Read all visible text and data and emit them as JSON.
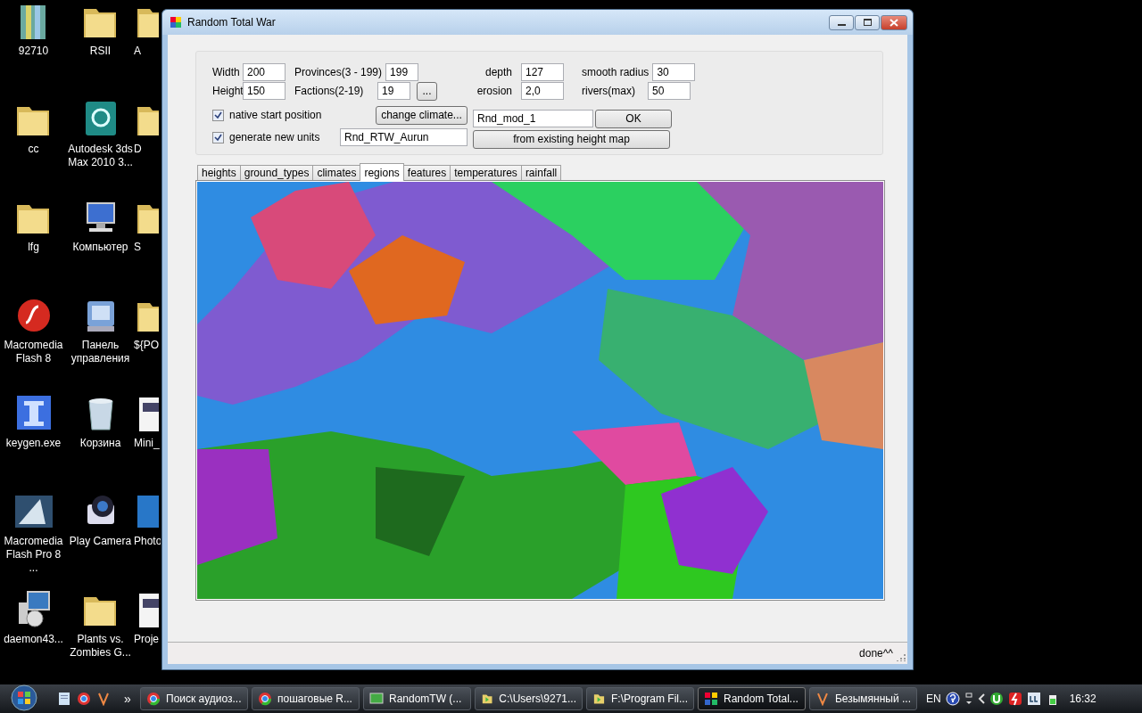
{
  "desktop": {
    "icons": [
      {
        "label": "92710",
        "kind": "archive"
      },
      {
        "label": "RSII",
        "kind": "folder"
      },
      {
        "label": "A",
        "kind": "folder"
      },
      {
        "label": "cc",
        "kind": "folder"
      },
      {
        "label": "Autodesk 3ds Max 2010 3...",
        "kind": "max"
      },
      {
        "label": "D",
        "kind": "folder"
      },
      {
        "label": "lfg",
        "kind": "folder"
      },
      {
        "label": "Компьютер",
        "kind": "computer"
      },
      {
        "label": "S",
        "kind": "folder"
      },
      {
        "label": "Macromedia Flash 8",
        "kind": "flash"
      },
      {
        "label": "Панель управления",
        "kind": "panel"
      },
      {
        "label": "${PO",
        "kind": "folder"
      },
      {
        "label": "keygen.exe",
        "kind": "keygen"
      },
      {
        "label": "Корзина",
        "kind": "bin"
      },
      {
        "label": "Mini_",
        "kind": "doc"
      },
      {
        "label": "Macromedia Flash Pro 8 ...",
        "kind": "flashpro"
      },
      {
        "label": "Play Camera",
        "kind": "camera"
      },
      {
        "label": "Photo",
        "kind": "app"
      },
      {
        "label": "daemon43...",
        "kind": "daemon"
      },
      {
        "label": "Plants vs. Zombies G...",
        "kind": "folder"
      },
      {
        "label": "Proje",
        "kind": "doc"
      }
    ]
  },
  "window": {
    "title": "Random Total War",
    "form": {
      "width": {
        "label": "Width",
        "value": "200"
      },
      "height": {
        "label": "Height",
        "value": "150"
      },
      "provinces": {
        "label": "Provinces(3 - 199)",
        "value": "199"
      },
      "factions": {
        "label": "Factions(2-19)",
        "value": "19"
      },
      "more_button": "...",
      "depth": {
        "label": "depth",
        "value": "127"
      },
      "erosion": {
        "label": "erosion",
        "value": "2,0"
      },
      "smooth_radius": {
        "label": "smooth radius",
        "value": "30"
      },
      "rivers": {
        "label": "rivers(max)",
        "value": "50"
      },
      "native_start": {
        "label": "native start position",
        "checked": true
      },
      "change_climate_button": "change climate...",
      "mod_name": {
        "value": "Rnd_mod_1"
      },
      "ok_button": "OK",
      "generate_units": {
        "label": "generate new units",
        "checked": true,
        "value": "Rnd_RTW_Aurun"
      },
      "height_map_button": "from existing height map"
    },
    "tabs": [
      {
        "label": "heights",
        "selected": false
      },
      {
        "label": "ground_types",
        "selected": false
      },
      {
        "label": "climates",
        "selected": false
      },
      {
        "label": "regions",
        "selected": true
      },
      {
        "label": "features",
        "selected": false
      },
      {
        "label": "temperatures",
        "selected": false
      },
      {
        "label": "rainfall",
        "selected": false
      }
    ],
    "status_bar": {
      "text": "done^^"
    }
  },
  "taskbar": {
    "overflow": "»",
    "tasks": [
      {
        "label": "Поиск аудиоз...",
        "kind": "chrome",
        "active": false
      },
      {
        "label": "пошаговые R...",
        "kind": "chrome",
        "active": false
      },
      {
        "label": "RandomTW (...",
        "kind": "csharp",
        "active": false
      },
      {
        "label": "C:\\Users\\9271...",
        "kind": "folder",
        "active": false
      },
      {
        "label": "F:\\Program Fil...",
        "kind": "folder",
        "active": false
      },
      {
        "label": "Random Total...",
        "kind": "app",
        "active": true
      },
      {
        "label": "Безымянный ...",
        "kind": "paint",
        "active": false
      }
    ],
    "language": "EN",
    "clock": "16:32"
  }
}
